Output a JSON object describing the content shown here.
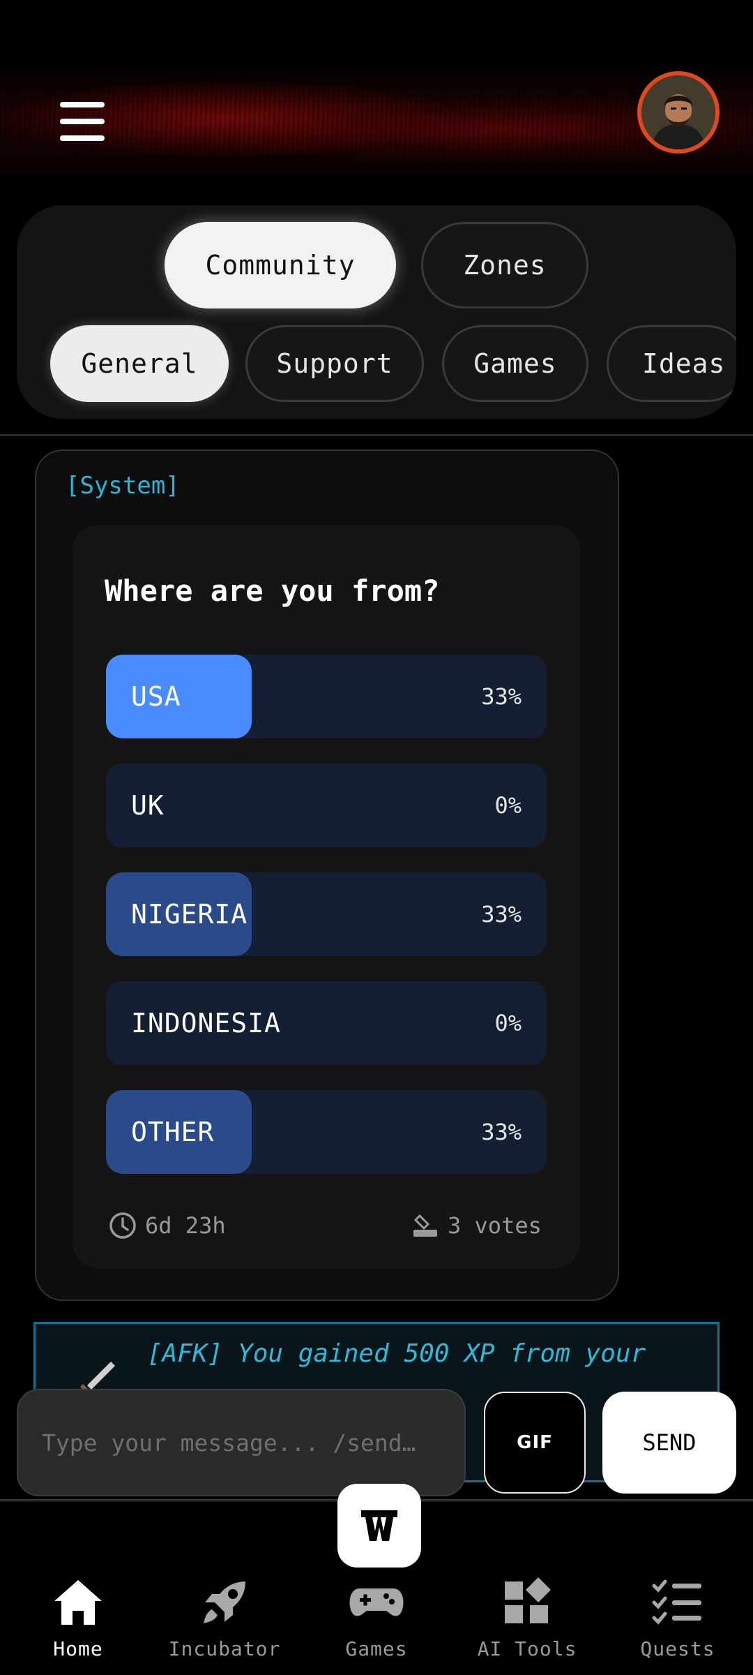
{
  "header": {
    "menu_icon": "hamburger-menu-icon",
    "avatar_icon": "user-avatar"
  },
  "tabs": {
    "primary": [
      {
        "label": "Community",
        "selected": true
      },
      {
        "label": "Zones",
        "selected": false
      }
    ],
    "channels": [
      {
        "label": "General",
        "selected": true
      },
      {
        "label": "Support",
        "selected": false
      },
      {
        "label": "Games",
        "selected": false
      },
      {
        "label": "Ideas",
        "selected": false
      }
    ]
  },
  "message": {
    "sender_tag": "[System]",
    "poll": {
      "question": "Where are you from?",
      "options": [
        {
          "label": "USA",
          "percent_text": "33%",
          "percent": 33,
          "fill_color": "#4a8cff",
          "voted": true
        },
        {
          "label": "UK",
          "percent_text": "0%",
          "percent": 0,
          "fill_color": "#2a4a8a",
          "voted": false
        },
        {
          "label": "NIGERIA",
          "percent_text": "33%",
          "percent": 33,
          "fill_color": "#2a4a8a",
          "voted": false
        },
        {
          "label": "INDONESIA",
          "percent_text": "0%",
          "percent": 0,
          "fill_color": "#2a4a8a",
          "voted": false
        },
        {
          "label": "OTHER",
          "percent_text": "33%",
          "percent": 33,
          "fill_color": "#2a4a8a",
          "voted": false
        }
      ],
      "time_left": "6d 23h",
      "votes": "3 votes"
    }
  },
  "afk_notice": {
    "text": "[AFK] You gained 500 XP from your",
    "icon": "dagger-icon"
  },
  "composer": {
    "placeholder": "Type your message... /send…",
    "gif_label": "GIF",
    "send_label": "SEND"
  },
  "bottom_nav": [
    {
      "label": "Home",
      "icon": "home-icon",
      "active": true
    },
    {
      "label": "Incubator",
      "icon": "rocket-icon",
      "active": false
    },
    {
      "label": "Games",
      "icon": "gamepad-icon",
      "active": false
    },
    {
      "label": "AI Tools",
      "icon": "widgets-icon",
      "active": false
    },
    {
      "label": "Quests",
      "icon": "checklist-icon",
      "active": false
    }
  ],
  "colors": {
    "accent_cyan": "#28b7d6",
    "avatar_ring": "#e0491e",
    "poll_bar": "#151f33",
    "voted_fill": "#4a8cff",
    "other_fill": "#2a4a8a"
  }
}
